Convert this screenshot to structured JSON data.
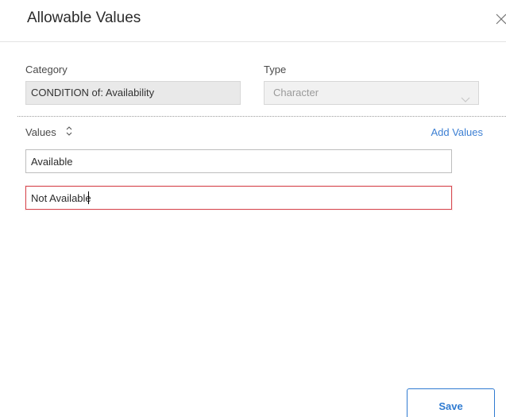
{
  "dialog": {
    "title": "Allowable Values",
    "close_icon": "close-icon"
  },
  "category": {
    "label": "Category",
    "value": "CONDITION of: Availability"
  },
  "type": {
    "label": "Type",
    "value": "Character",
    "icon": "chevron-down-icon"
  },
  "values": {
    "label": "Values",
    "sort_icon": "sort-updown-icon",
    "add_label": "Add Values",
    "items": [
      {
        "value": "Available"
      },
      {
        "value": "Not Available"
      }
    ]
  },
  "footer": {
    "save_label": "Save"
  },
  "colors": {
    "accent": "#2f7bd1",
    "error_border": "#d7484f"
  }
}
